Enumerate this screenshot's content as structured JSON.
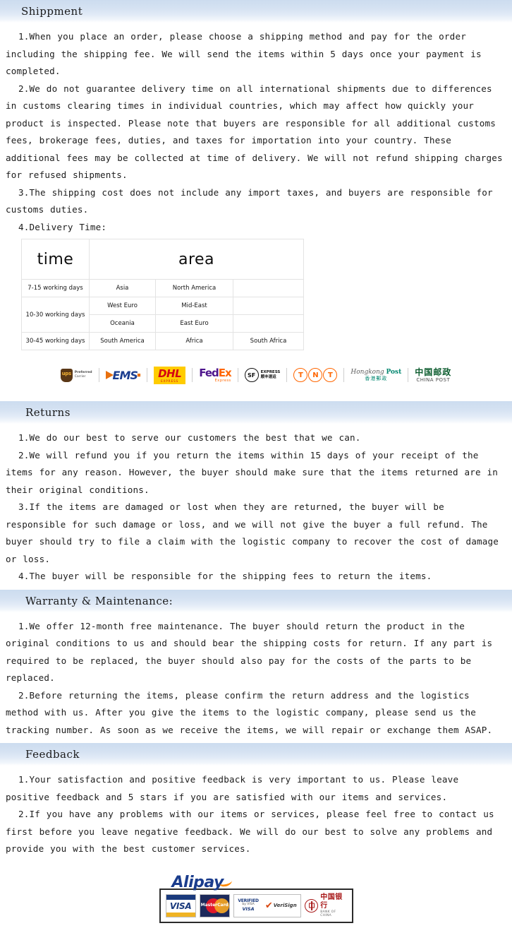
{
  "sections": {
    "shipment": {
      "title": "Shippment",
      "paragraphs": [
        "1.When you place an order, please choose a shipping method and pay for the order including the shipping fee. We will send the items within 5 days once your payment is completed.",
        "2.We do not guarantee delivery time on all international shipments due to differences in customs clearing times in individual countries, which may affect how quickly your product is inspected. Please note that buyers are responsible for all additional customs fees, brokerage fees, duties, and taxes for importation into your country. These additional fees may be collected at time of delivery. We will not refund shipping charges for refused shipments.",
        "3.The shipping cost does not include any import taxes, and buyers are responsible for customs duties.",
        "4.Delivery Time:"
      ]
    },
    "returns": {
      "title": "Returns",
      "paragraphs": [
        "1.We do our best to serve our customers the best that we can.",
        "2.We will refund you if you return the items within 15 days of your receipt of the items for any reason. However, the buyer should make sure that the items returned are in their original conditions.",
        "3.If the items are damaged or lost when they are returned, the buyer will be responsible for such damage or loss, and we will not give the buyer a full refund.  The buyer should try to file a claim with the logistic company to recover the cost of damage or loss.",
        "4.The buyer will be responsible for the shipping fees to return the items."
      ]
    },
    "warranty": {
      "title": "Warranty & Maintenance:",
      "paragraphs": [
        "1.We offer 12-month free maintenance.  The buyer should return the product in the original conditions to us and should bear the shipping costs for return.  If any part is required to be replaced, the buyer should also pay for the costs of the parts to be replaced.",
        "2.Before returning the items, please confirm the return address and the logistics method with us. After you give the items to the logistic company, please send us the tracking number.  As soon as we receive the items, we will repair or exchange them ASAP."
      ]
    },
    "feedback": {
      "title": "Feedback",
      "paragraphs": [
        "1.Your satisfaction and positive feedback is very important to us.  Please leave positive feedback and 5 stars if you are satisfied with our items and services.",
        "2.If you have any problems with our items or services, please feel free to contact us first before you leave negative feedback.  We will do our best to solve any problems and provide you with the best customer services."
      ]
    }
  },
  "delivery_table": {
    "headers": [
      "time",
      "area"
    ],
    "rows": [
      {
        "time": "7-15 working days",
        "areas": [
          "Asia",
          "North America",
          ""
        ]
      },
      {
        "time": "10-30 working days",
        "areas": [
          "West Euro",
          "Mid-East",
          ""
        ]
      },
      {
        "time": "",
        "areas": [
          "Oceania",
          "East Euro",
          ""
        ]
      },
      {
        "time": "30-45 working days",
        "areas": [
          "South America",
          "Africa",
          "South Africa"
        ]
      }
    ]
  },
  "carriers": [
    {
      "id": "ups-logo",
      "name": "ups",
      "sub_line1": "Preferred",
      "sub_line2": "Carrier"
    },
    {
      "id": "ems-logo",
      "name": "EMS"
    },
    {
      "id": "dhl-logo",
      "name": "DHL",
      "sub": "EXPRESS"
    },
    {
      "id": "fedex-logo",
      "name_part1": "Fed",
      "name_part2": "Ex",
      "sub": "Express"
    },
    {
      "id": "sf-express-logo",
      "name": "SF",
      "sub_line1": "EXPRESS",
      "sub_line2": "顺丰速运"
    },
    {
      "id": "tnt-logo",
      "letters": [
        "T",
        "N",
        "T"
      ]
    },
    {
      "id": "hongkong-post-logo",
      "en_italic": "Hongkong ",
      "en_bold": "Post",
      "cn": "香港郵政"
    },
    {
      "id": "china-post-logo",
      "cn": "中国邮政",
      "en": "CHINA POST"
    }
  ],
  "payment": {
    "alipay_label": "Alipay",
    "cards": [
      {
        "id": "visa-card",
        "label": "VISA"
      },
      {
        "id": "mastercard-card",
        "label": "MasterCard"
      },
      {
        "id": "verified-by-visa-badge",
        "line1": "VERIFIED",
        "line2": "by VISA",
        "line3": "VISA"
      },
      {
        "id": "verisign-badge",
        "check": "✔",
        "label": "VeriSign"
      },
      {
        "id": "bank-of-china-logo",
        "cn": "中国银行",
        "en": "BANK OF CHINA"
      }
    ]
  },
  "colors": {
    "header_gradient_start": "#ccdcef",
    "header_gradient_end": "#ffffff",
    "text": "#1c1c1c",
    "ems_blue": "#1b3d8f",
    "ems_orange": "#e8700f",
    "dhl_yellow": "#ffcc00",
    "dhl_red": "#d40511",
    "fedex_purple": "#4d148c",
    "fedex_orange": "#ff6600",
    "tnt_orange": "#ff6600",
    "hkpost_green": "#00866f",
    "chinapost_green": "#0d5c2f",
    "alipay_blue": "#1a3c8c",
    "boc_red": "#a81919"
  }
}
